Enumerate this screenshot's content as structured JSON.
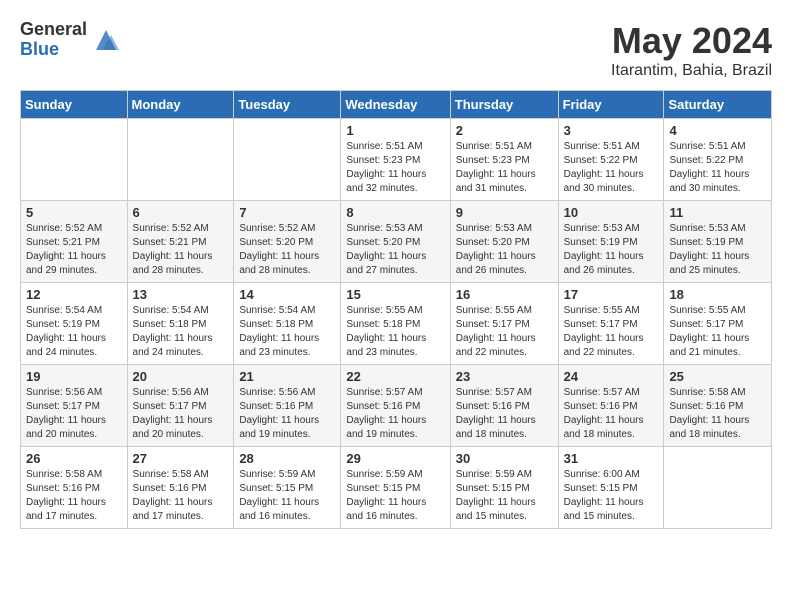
{
  "header": {
    "logo_general": "General",
    "logo_blue": "Blue",
    "title": "May 2024",
    "location": "Itarantim, Bahia, Brazil"
  },
  "days_of_week": [
    "Sunday",
    "Monday",
    "Tuesday",
    "Wednesday",
    "Thursday",
    "Friday",
    "Saturday"
  ],
  "weeks": [
    [
      {
        "day": "",
        "info": ""
      },
      {
        "day": "",
        "info": ""
      },
      {
        "day": "",
        "info": ""
      },
      {
        "day": "1",
        "info": "Sunrise: 5:51 AM\nSunset: 5:23 PM\nDaylight: 11 hours\nand 32 minutes."
      },
      {
        "day": "2",
        "info": "Sunrise: 5:51 AM\nSunset: 5:23 PM\nDaylight: 11 hours\nand 31 minutes."
      },
      {
        "day": "3",
        "info": "Sunrise: 5:51 AM\nSunset: 5:22 PM\nDaylight: 11 hours\nand 30 minutes."
      },
      {
        "day": "4",
        "info": "Sunrise: 5:51 AM\nSunset: 5:22 PM\nDaylight: 11 hours\nand 30 minutes."
      }
    ],
    [
      {
        "day": "5",
        "info": "Sunrise: 5:52 AM\nSunset: 5:21 PM\nDaylight: 11 hours\nand 29 minutes."
      },
      {
        "day": "6",
        "info": "Sunrise: 5:52 AM\nSunset: 5:21 PM\nDaylight: 11 hours\nand 28 minutes."
      },
      {
        "day": "7",
        "info": "Sunrise: 5:52 AM\nSunset: 5:20 PM\nDaylight: 11 hours\nand 28 minutes."
      },
      {
        "day": "8",
        "info": "Sunrise: 5:53 AM\nSunset: 5:20 PM\nDaylight: 11 hours\nand 27 minutes."
      },
      {
        "day": "9",
        "info": "Sunrise: 5:53 AM\nSunset: 5:20 PM\nDaylight: 11 hours\nand 26 minutes."
      },
      {
        "day": "10",
        "info": "Sunrise: 5:53 AM\nSunset: 5:19 PM\nDaylight: 11 hours\nand 26 minutes."
      },
      {
        "day": "11",
        "info": "Sunrise: 5:53 AM\nSunset: 5:19 PM\nDaylight: 11 hours\nand 25 minutes."
      }
    ],
    [
      {
        "day": "12",
        "info": "Sunrise: 5:54 AM\nSunset: 5:19 PM\nDaylight: 11 hours\nand 24 minutes."
      },
      {
        "day": "13",
        "info": "Sunrise: 5:54 AM\nSunset: 5:18 PM\nDaylight: 11 hours\nand 24 minutes."
      },
      {
        "day": "14",
        "info": "Sunrise: 5:54 AM\nSunset: 5:18 PM\nDaylight: 11 hours\nand 23 minutes."
      },
      {
        "day": "15",
        "info": "Sunrise: 5:55 AM\nSunset: 5:18 PM\nDaylight: 11 hours\nand 23 minutes."
      },
      {
        "day": "16",
        "info": "Sunrise: 5:55 AM\nSunset: 5:17 PM\nDaylight: 11 hours\nand 22 minutes."
      },
      {
        "day": "17",
        "info": "Sunrise: 5:55 AM\nSunset: 5:17 PM\nDaylight: 11 hours\nand 22 minutes."
      },
      {
        "day": "18",
        "info": "Sunrise: 5:55 AM\nSunset: 5:17 PM\nDaylight: 11 hours\nand 21 minutes."
      }
    ],
    [
      {
        "day": "19",
        "info": "Sunrise: 5:56 AM\nSunset: 5:17 PM\nDaylight: 11 hours\nand 20 minutes."
      },
      {
        "day": "20",
        "info": "Sunrise: 5:56 AM\nSunset: 5:17 PM\nDaylight: 11 hours\nand 20 minutes."
      },
      {
        "day": "21",
        "info": "Sunrise: 5:56 AM\nSunset: 5:16 PM\nDaylight: 11 hours\nand 19 minutes."
      },
      {
        "day": "22",
        "info": "Sunrise: 5:57 AM\nSunset: 5:16 PM\nDaylight: 11 hours\nand 19 minutes."
      },
      {
        "day": "23",
        "info": "Sunrise: 5:57 AM\nSunset: 5:16 PM\nDaylight: 11 hours\nand 18 minutes."
      },
      {
        "day": "24",
        "info": "Sunrise: 5:57 AM\nSunset: 5:16 PM\nDaylight: 11 hours\nand 18 minutes."
      },
      {
        "day": "25",
        "info": "Sunrise: 5:58 AM\nSunset: 5:16 PM\nDaylight: 11 hours\nand 18 minutes."
      }
    ],
    [
      {
        "day": "26",
        "info": "Sunrise: 5:58 AM\nSunset: 5:16 PM\nDaylight: 11 hours\nand 17 minutes."
      },
      {
        "day": "27",
        "info": "Sunrise: 5:58 AM\nSunset: 5:16 PM\nDaylight: 11 hours\nand 17 minutes."
      },
      {
        "day": "28",
        "info": "Sunrise: 5:59 AM\nSunset: 5:15 PM\nDaylight: 11 hours\nand 16 minutes."
      },
      {
        "day": "29",
        "info": "Sunrise: 5:59 AM\nSunset: 5:15 PM\nDaylight: 11 hours\nand 16 minutes."
      },
      {
        "day": "30",
        "info": "Sunrise: 5:59 AM\nSunset: 5:15 PM\nDaylight: 11 hours\nand 15 minutes."
      },
      {
        "day": "31",
        "info": "Sunrise: 6:00 AM\nSunset: 5:15 PM\nDaylight: 11 hours\nand 15 minutes."
      },
      {
        "day": "",
        "info": ""
      }
    ]
  ]
}
